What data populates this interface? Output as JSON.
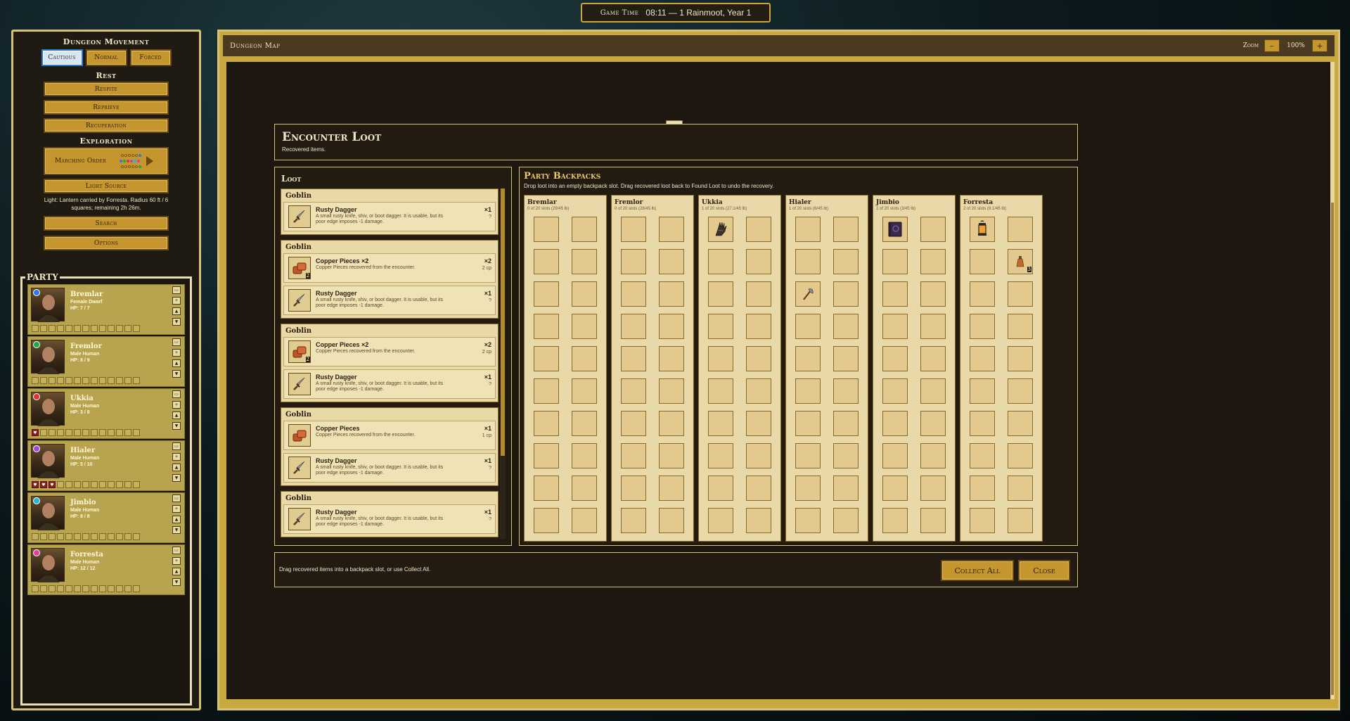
{
  "game_time": {
    "label": "Game Time",
    "value": "08:11 — 1 Rainmoot, Year 1"
  },
  "sidebar": {
    "movement_title": "Dungeon Movement",
    "movement": [
      "Cautious",
      "Normal",
      "Forced"
    ],
    "rest_title": "Rest",
    "rest": [
      "Respite",
      "Reprieve",
      "Recuperation"
    ],
    "exploration_title": "Exploration",
    "marching_order": "Marching Order",
    "light_source": "Light Source",
    "light_text": "Light: Lantern carried by Forresta. Radius 60 ft / 6 squares; remaining 2h 26m.",
    "search": "Search",
    "options": "Options"
  },
  "party": {
    "title": "PARTY",
    "members": [
      {
        "name": "Bremlar",
        "desc": "Female  Dwarf",
        "hp": "HP:  7 / 7",
        "color": "#2e78e8"
      },
      {
        "name": "Fremlor",
        "desc": "Male  Human",
        "hp": "HP:  8 / 9",
        "color": "#1fa84a"
      },
      {
        "name": "Ukkia",
        "desc": "Male  Human",
        "hp": "HP:  3 / 8",
        "color": "#e82e2e"
      },
      {
        "name": "Hialer",
        "desc": "Male  Human",
        "hp": "HP:  5 / 10",
        "color": "#a04ad8"
      },
      {
        "name": "Jimbio",
        "desc": "Male  Human",
        "hp": "HP:  8 / 8",
        "color": "#1fb8d8"
      },
      {
        "name": "Forresta",
        "desc": "Male  Human",
        "hp": "HP:  12 / 12",
        "color": "#e83aa0"
      }
    ]
  },
  "map": {
    "title": "Dungeon Map",
    "zoom_label": "Zoom",
    "zoom_value": "100%",
    "zoom_out": "–",
    "zoom_in": "+"
  },
  "encounter": {
    "title": "Encounter Loot",
    "subtitle": "Recovered items."
  },
  "loot": {
    "title": "Loot",
    "groups": [
      {
        "name": "Goblin",
        "items": [
          {
            "name": "Rusty Dagger",
            "desc": "A small rusty knife, shiv, or boot dagger. It is usable, but its poor edge imposes -1 damage.",
            "qty": "×1",
            "value": "?"
          }
        ]
      },
      {
        "name": "Goblin",
        "items": [
          {
            "name": "Copper Pieces ×2",
            "desc": "Copper Pieces recovered from the encounter.",
            "qty": "×2",
            "value": "2 cp",
            "badge": "2"
          },
          {
            "name": "Rusty Dagger",
            "desc": "A small rusty knife, shiv, or boot dagger. It is usable, but its poor edge imposes -1 damage.",
            "qty": "×1",
            "value": "?"
          }
        ]
      },
      {
        "name": "Goblin",
        "items": [
          {
            "name": "Copper Pieces ×2",
            "desc": "Copper Pieces recovered from the encounter.",
            "qty": "×2",
            "value": "2 cp",
            "badge": "2"
          },
          {
            "name": "Rusty Dagger",
            "desc": "A small rusty knife, shiv, or boot dagger. It is usable, but its poor edge imposes -1 damage.",
            "qty": "×1",
            "value": "?"
          }
        ]
      },
      {
        "name": "Goblin",
        "items": [
          {
            "name": "Copper Pieces",
            "desc": "Copper Pieces recovered from the encounter.",
            "qty": "×1",
            "value": "1 cp"
          },
          {
            "name": "Rusty Dagger",
            "desc": "A small rusty knife, shiv, or boot dagger. It is usable, but its poor edge imposes -1 damage.",
            "qty": "×1",
            "value": "?"
          }
        ]
      },
      {
        "name": "Goblin",
        "items": [
          {
            "name": "Rusty Dagger",
            "desc": "A small rusty knife, shiv, or boot dagger. It is usable, but its poor edge imposes -1 damage.",
            "qty": "×1",
            "value": "?"
          }
        ]
      }
    ]
  },
  "backpacks": {
    "title": "Party Backpacks",
    "subtitle": "Drop loot into an empty backpack slot. Drag recovered loot back to Found Loot to undo the recovery.",
    "members": [
      {
        "name": "Bremlar",
        "cap": "0 of 20 slots (29/45 lb)"
      },
      {
        "name": "Fremlor",
        "cap": "0 of 20 slots (28/45 lb)"
      },
      {
        "name": "Ukkia",
        "cap": "1 of 20 slots (27.1/45 lb)"
      },
      {
        "name": "Hialer",
        "cap": "1 of 20 slots (6/45 lb)"
      },
      {
        "name": "Jimbio",
        "cap": "1 of 20 slots (3/45 lb)"
      },
      {
        "name": "Forresta",
        "cap": "2 of 20 slots (8.1/45 lb)"
      }
    ],
    "icons": [
      "gauntlet-icon",
      "axe-icon",
      "spellbook-icon",
      "lantern-icon",
      "potion-icon"
    ],
    "potion_badge": "3"
  },
  "footer": {
    "hint": "Drag recovered items into a backpack slot, or use Collect All.",
    "collect_all": "Collect All",
    "close": "Close"
  }
}
